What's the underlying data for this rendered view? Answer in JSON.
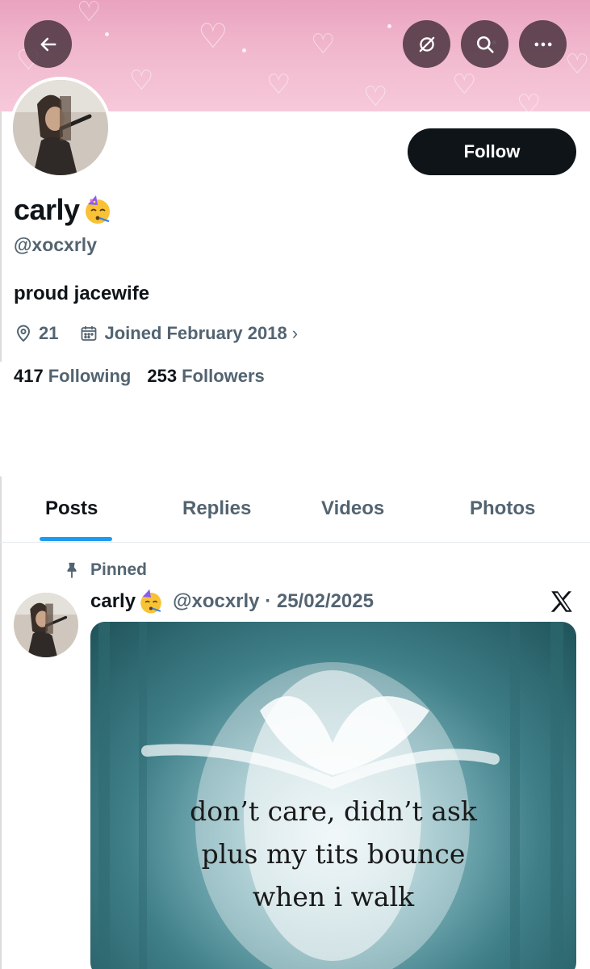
{
  "header": {
    "back_icon": "arrow-left-icon",
    "grok_icon": "grok-icon",
    "search_icon": "search-icon",
    "more_icon": "more-horizontal-icon",
    "banner_color": "#f1b8cd"
  },
  "profile": {
    "display_name": "carly",
    "display_name_emoji": "partying-face-emoji",
    "handle": "@xocxrly",
    "follow_label": "Follow",
    "bio": "proud jacewife",
    "location": "21",
    "joined": "Joined February 2018",
    "following_count": "417",
    "following_label": "Following",
    "followers_count": "253",
    "followers_label": "Followers"
  },
  "tabs": [
    {
      "label": "Posts",
      "active": true
    },
    {
      "label": "Replies",
      "active": false
    },
    {
      "label": "Videos",
      "active": false
    },
    {
      "label": "Photos",
      "active": false
    }
  ],
  "post": {
    "pinned_label": "Pinned",
    "author_name": "carly",
    "handle_date": "@xocxrly · 25/02/2025",
    "media_text": [
      "don’t care, didn’t ask",
      "plus my tits bounce",
      "when i walk"
    ]
  },
  "colors": {
    "accent": "#1d9bf0",
    "text_primary": "#0f1419",
    "text_secondary": "#536471",
    "button_bg": "#0f1419"
  }
}
